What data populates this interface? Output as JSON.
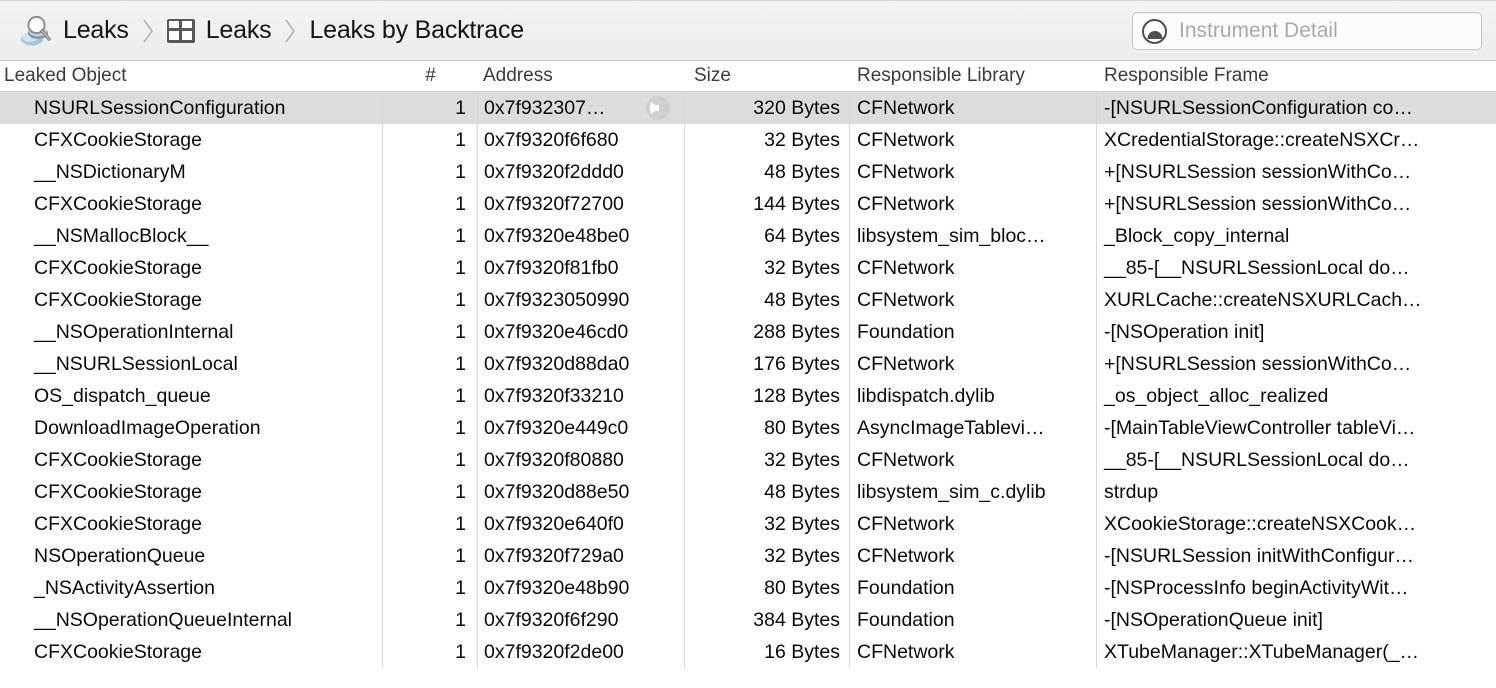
{
  "jumpbar": {
    "instrument_name": "Leaks",
    "instrument_icon": "leaks-drop-magnifier-icon",
    "view_name": "Leaks",
    "view_icon": "grid-table-icon",
    "detail_name": "Leaks by Backtrace",
    "separator_icon": "chevron-right-icon"
  },
  "search": {
    "icon": "instrument-detail-circle-icon",
    "placeholder": "Instrument Detail",
    "value": ""
  },
  "table": {
    "columns": [
      {
        "key": "object",
        "label": "Leaked Object"
      },
      {
        "key": "count",
        "label": "#"
      },
      {
        "key": "address",
        "label": "Address"
      },
      {
        "key": "size",
        "label": "Size"
      },
      {
        "key": "library",
        "label": "Responsible Library"
      },
      {
        "key": "frame",
        "label": "Responsible Frame"
      }
    ],
    "rows": [
      {
        "object": "NSURLSessionConfiguration",
        "count": "1",
        "address": "0x7f932307…",
        "size": "320 Bytes",
        "library": "CFNetwork",
        "frame": "-[NSURLSessionConfiguration co…",
        "selected": true,
        "has_disclosure": true
      },
      {
        "object": "CFXCookieStorage",
        "count": "1",
        "address": "0x7f9320f6f680",
        "size": "32 Bytes",
        "library": "CFNetwork",
        "frame": "XCredentialStorage::createNSXCr…",
        "selected": false,
        "has_disclosure": false
      },
      {
        "object": "__NSDictionaryM",
        "count": "1",
        "address": "0x7f9320f2ddd0",
        "size": "48 Bytes",
        "library": "CFNetwork",
        "frame": "+[NSURLSession sessionWithCo…",
        "selected": false,
        "has_disclosure": false
      },
      {
        "object": "CFXCookieStorage",
        "count": "1",
        "address": "0x7f9320f72700",
        "size": "144 Bytes",
        "library": "CFNetwork",
        "frame": "+[NSURLSession sessionWithCo…",
        "selected": false,
        "has_disclosure": false
      },
      {
        "object": "__NSMallocBlock__",
        "count": "1",
        "address": "0x7f9320e48be0",
        "size": "64 Bytes",
        "library": "libsystem_sim_bloc…",
        "frame": "_Block_copy_internal",
        "selected": false,
        "has_disclosure": false
      },
      {
        "object": "CFXCookieStorage",
        "count": "1",
        "address": "0x7f9320f81fb0",
        "size": "32 Bytes",
        "library": "CFNetwork",
        "frame": "__85-[__NSURLSessionLocal do…",
        "selected": false,
        "has_disclosure": false
      },
      {
        "object": "CFXCookieStorage",
        "count": "1",
        "address": "0x7f9323050990",
        "size": "48 Bytes",
        "library": "CFNetwork",
        "frame": "XURLCache::createNSXURLCach…",
        "selected": false,
        "has_disclosure": false
      },
      {
        "object": "__NSOperationInternal",
        "count": "1",
        "address": "0x7f9320e46cd0",
        "size": "288 Bytes",
        "library": "Foundation",
        "frame": "-[NSOperation init]",
        "selected": false,
        "has_disclosure": false
      },
      {
        "object": "__NSURLSessionLocal",
        "count": "1",
        "address": "0x7f9320d88da0",
        "size": "176 Bytes",
        "library": "CFNetwork",
        "frame": "+[NSURLSession sessionWithCo…",
        "selected": false,
        "has_disclosure": false
      },
      {
        "object": "OS_dispatch_queue",
        "count": "1",
        "address": "0x7f9320f33210",
        "size": "128 Bytes",
        "library": "libdispatch.dylib",
        "frame": "_os_object_alloc_realized",
        "selected": false,
        "has_disclosure": false
      },
      {
        "object": "DownloadImageOperation",
        "count": "1",
        "address": "0x7f9320e449c0",
        "size": "80 Bytes",
        "library": "AsyncImageTablevi…",
        "frame": "-[MainTableViewController tableVi…",
        "selected": false,
        "has_disclosure": false
      },
      {
        "object": "CFXCookieStorage",
        "count": "1",
        "address": "0x7f9320f80880",
        "size": "32 Bytes",
        "library": "CFNetwork",
        "frame": "__85-[__NSURLSessionLocal do…",
        "selected": false,
        "has_disclosure": false
      },
      {
        "object": "CFXCookieStorage",
        "count": "1",
        "address": "0x7f9320d88e50",
        "size": "48 Bytes",
        "library": "libsystem_sim_c.dylib",
        "frame": "strdup",
        "selected": false,
        "has_disclosure": false
      },
      {
        "object": "CFXCookieStorage",
        "count": "1",
        "address": "0x7f9320e640f0",
        "size": "32 Bytes",
        "library": "CFNetwork",
        "frame": "XCookieStorage::createNSXCook…",
        "selected": false,
        "has_disclosure": false
      },
      {
        "object": "NSOperationQueue",
        "count": "1",
        "address": "0x7f9320f729a0",
        "size": "32 Bytes",
        "library": "CFNetwork",
        "frame": "-[NSURLSession initWithConfigur…",
        "selected": false,
        "has_disclosure": false
      },
      {
        "object": "_NSActivityAssertion",
        "count": "1",
        "address": "0x7f9320e48b90",
        "size": "80 Bytes",
        "library": "Foundation",
        "frame": "-[NSProcessInfo beginActivityWit…",
        "selected": false,
        "has_disclosure": false
      },
      {
        "object": "__NSOperationQueueInternal",
        "count": "1",
        "address": "0x7f9320f6f290",
        "size": "384 Bytes",
        "library": "Foundation",
        "frame": "-[NSOperationQueue init]",
        "selected": false,
        "has_disclosure": false
      },
      {
        "object": "CFXCookieStorage",
        "count": "1",
        "address": "0x7f9320f2de00",
        "size": "16 Bytes",
        "library": "CFNetwork",
        "frame": "XTubeManager::XTubeManager(_…",
        "selected": false,
        "has_disclosure": false
      }
    ]
  },
  "colors": {
    "selection": "#dcdcdc",
    "chrome": "#eeeeee",
    "divider": "#d6d6d6",
    "text": "#0a0a0a",
    "header_text": "#3b3b3b",
    "placeholder": "#a9a9a9"
  }
}
